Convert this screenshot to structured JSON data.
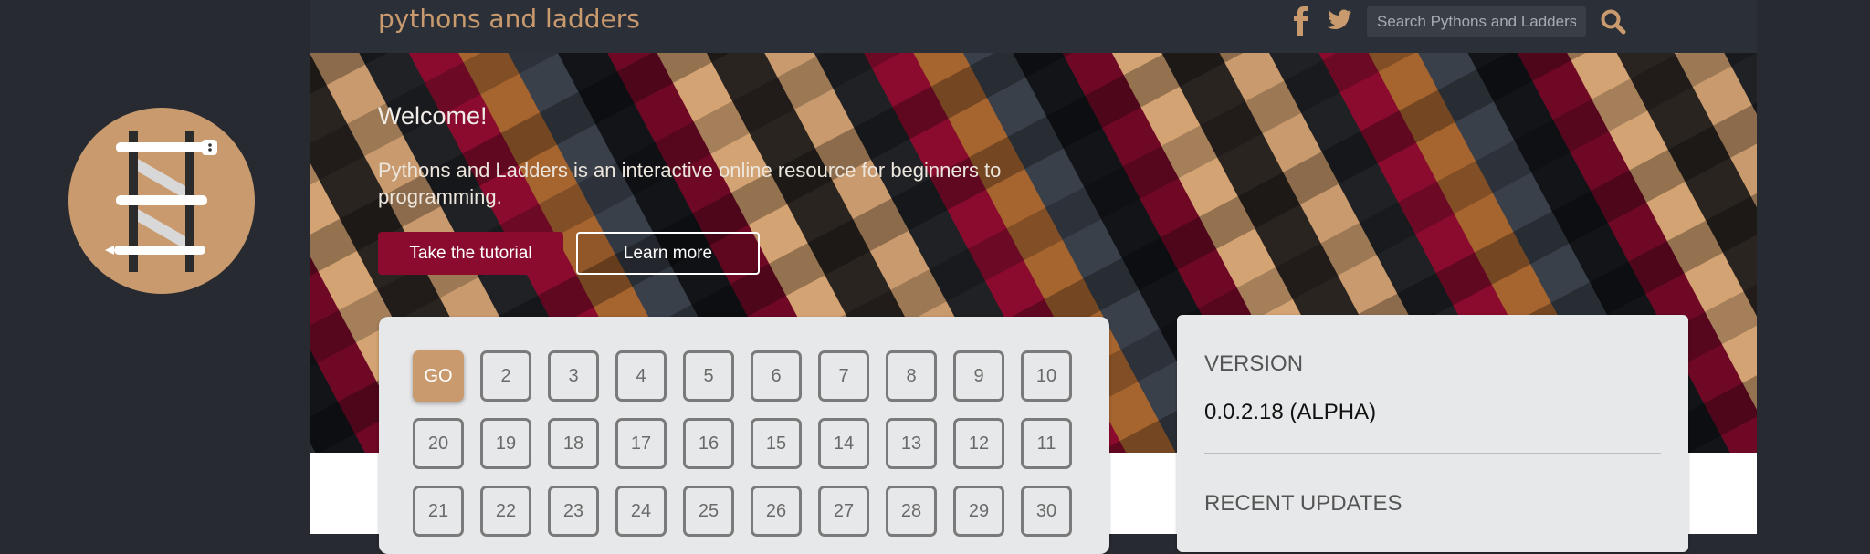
{
  "header": {
    "brand": "pythons and ladders",
    "search_placeholder": "Search Pythons and Ladders",
    "icons": [
      "facebook-icon",
      "twitter-icon",
      "search-icon"
    ]
  },
  "hero": {
    "welcome": "Welcome!",
    "lead": "Pythons and Ladders is an interactive online resource for beginners to programming.",
    "primary_button": "Take the tutorial",
    "secondary_button": "Learn more"
  },
  "lessons": {
    "rows": [
      [
        "GO",
        "2",
        "3",
        "4",
        "5",
        "6",
        "7",
        "8",
        "9",
        "10"
      ],
      [
        "20",
        "19",
        "18",
        "17",
        "16",
        "15",
        "14",
        "13",
        "12",
        "11"
      ],
      [
        "21",
        "22",
        "23",
        "24",
        "25",
        "26",
        "27",
        "28",
        "29",
        "30"
      ]
    ]
  },
  "info": {
    "version_title": "VERSION",
    "version_value": "0.0.2.18 (ALPHA)",
    "updates_title": "RECENT UPDATES"
  },
  "colors": {
    "background": "#272b31",
    "accent_tan": "#c99a6d",
    "accent_crimson": "#8a0b2e",
    "card": "#e7e8e9"
  }
}
